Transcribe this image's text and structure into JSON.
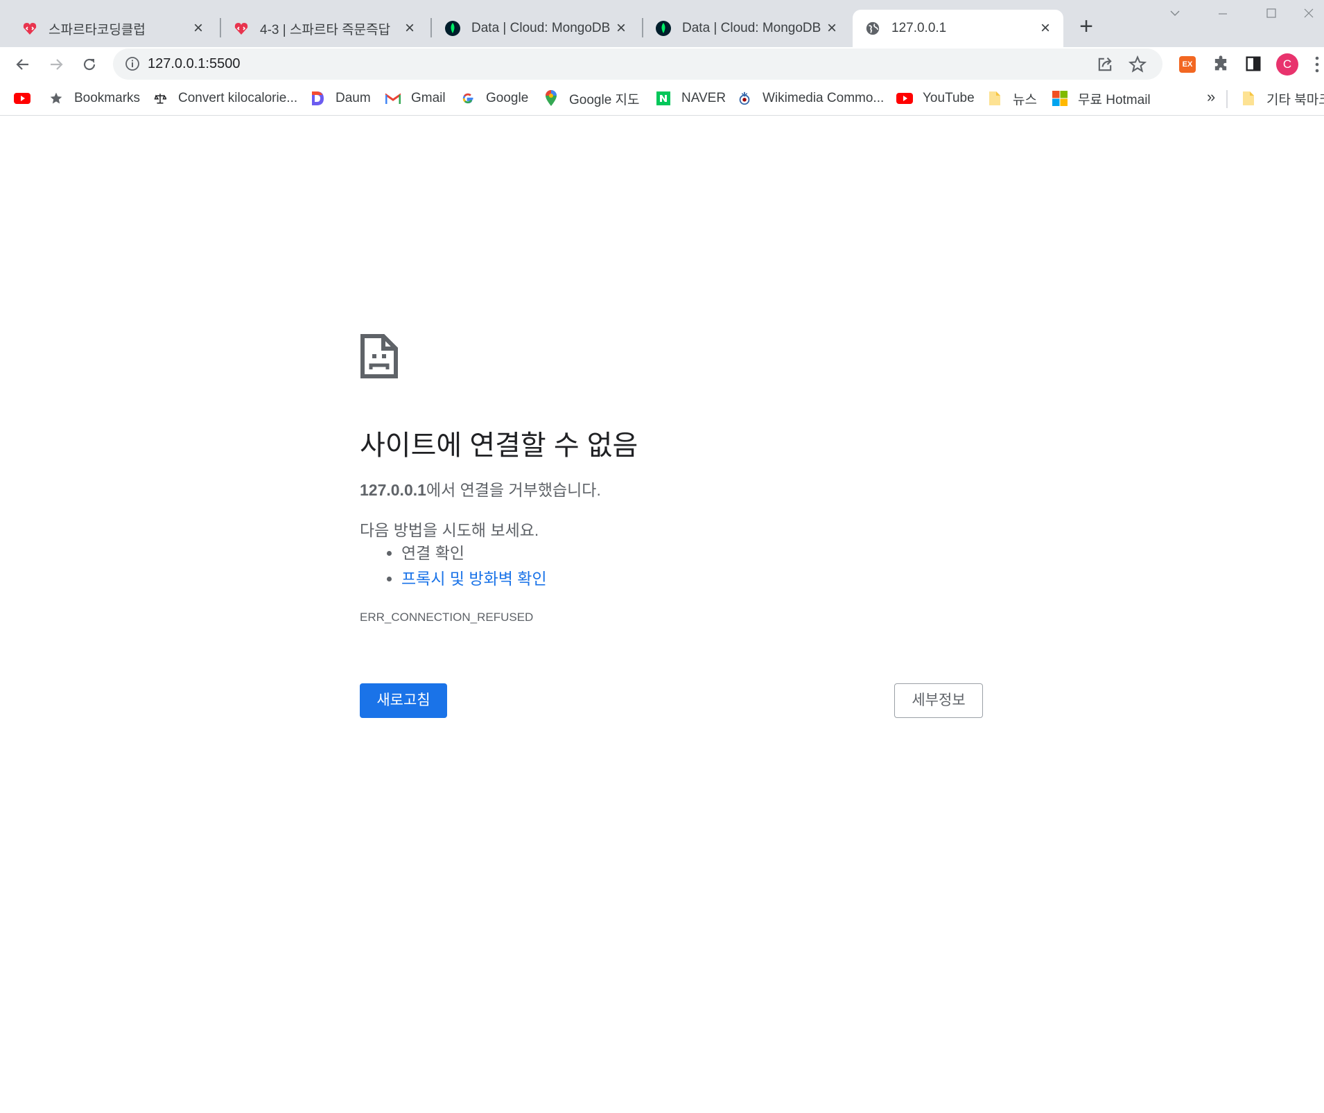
{
  "tabs": [
    {
      "title": "스파르타코딩클럽",
      "icon": "sparta-logo-icon"
    },
    {
      "title": "4-3 | 스파르타 즉문즉답",
      "icon": "sparta-logo-icon"
    },
    {
      "title": "Data | Cloud: MongoDB Cloud",
      "icon": "mongodb-leaf-icon"
    },
    {
      "title": "Data | Cloud: MongoDB Cloud",
      "icon": "mongodb-leaf-icon"
    },
    {
      "title": "127.0.0.1",
      "icon": "globe-icon",
      "active": true
    }
  ],
  "address_bar": {
    "url": "127.0.0.1:5500"
  },
  "bookmarks": [
    {
      "label": "",
      "icon": "youtube-icon"
    },
    {
      "label": "Bookmarks",
      "icon": "star-icon"
    },
    {
      "label": "Convert kilocalorie...",
      "icon": "scale-icon"
    },
    {
      "label": "Daum",
      "icon": "daum-icon"
    },
    {
      "label": "Gmail",
      "icon": "gmail-icon"
    },
    {
      "label": "Google",
      "icon": "google-icon"
    },
    {
      "label": "Google 지도",
      "icon": "google-maps-icon"
    },
    {
      "label": "NAVER",
      "icon": "naver-icon"
    },
    {
      "label": "Wikimedia Commo...",
      "icon": "wikimedia-icon"
    },
    {
      "label": "YouTube",
      "icon": "youtube-icon"
    },
    {
      "label": "뉴스",
      "icon": "folder-icon"
    },
    {
      "label": "무료 Hotmail",
      "icon": "microsoft-icon"
    }
  ],
  "bookmarks_more": "»",
  "other_bookmarks": "기타 북마크",
  "extensions": {
    "ex_label": "EX",
    "avatar_initial": "C"
  },
  "error_page": {
    "title": "사이트에 연결할 수 없음",
    "host": "127.0.0.1",
    "message_suffix": "에서 연결을 거부했습니다.",
    "try_heading": "다음 방법을 시도해 보세요.",
    "suggestions": [
      "연결 확인",
      "프록시 및 방화벽 확인"
    ],
    "error_code": "ERR_CONNECTION_REFUSED",
    "reload_button": "새로고침",
    "details_button": "세부정보"
  },
  "colors": {
    "accent": "#1a73e8",
    "tabstrip": "#dee1e6",
    "avatar": "#e8336d"
  }
}
